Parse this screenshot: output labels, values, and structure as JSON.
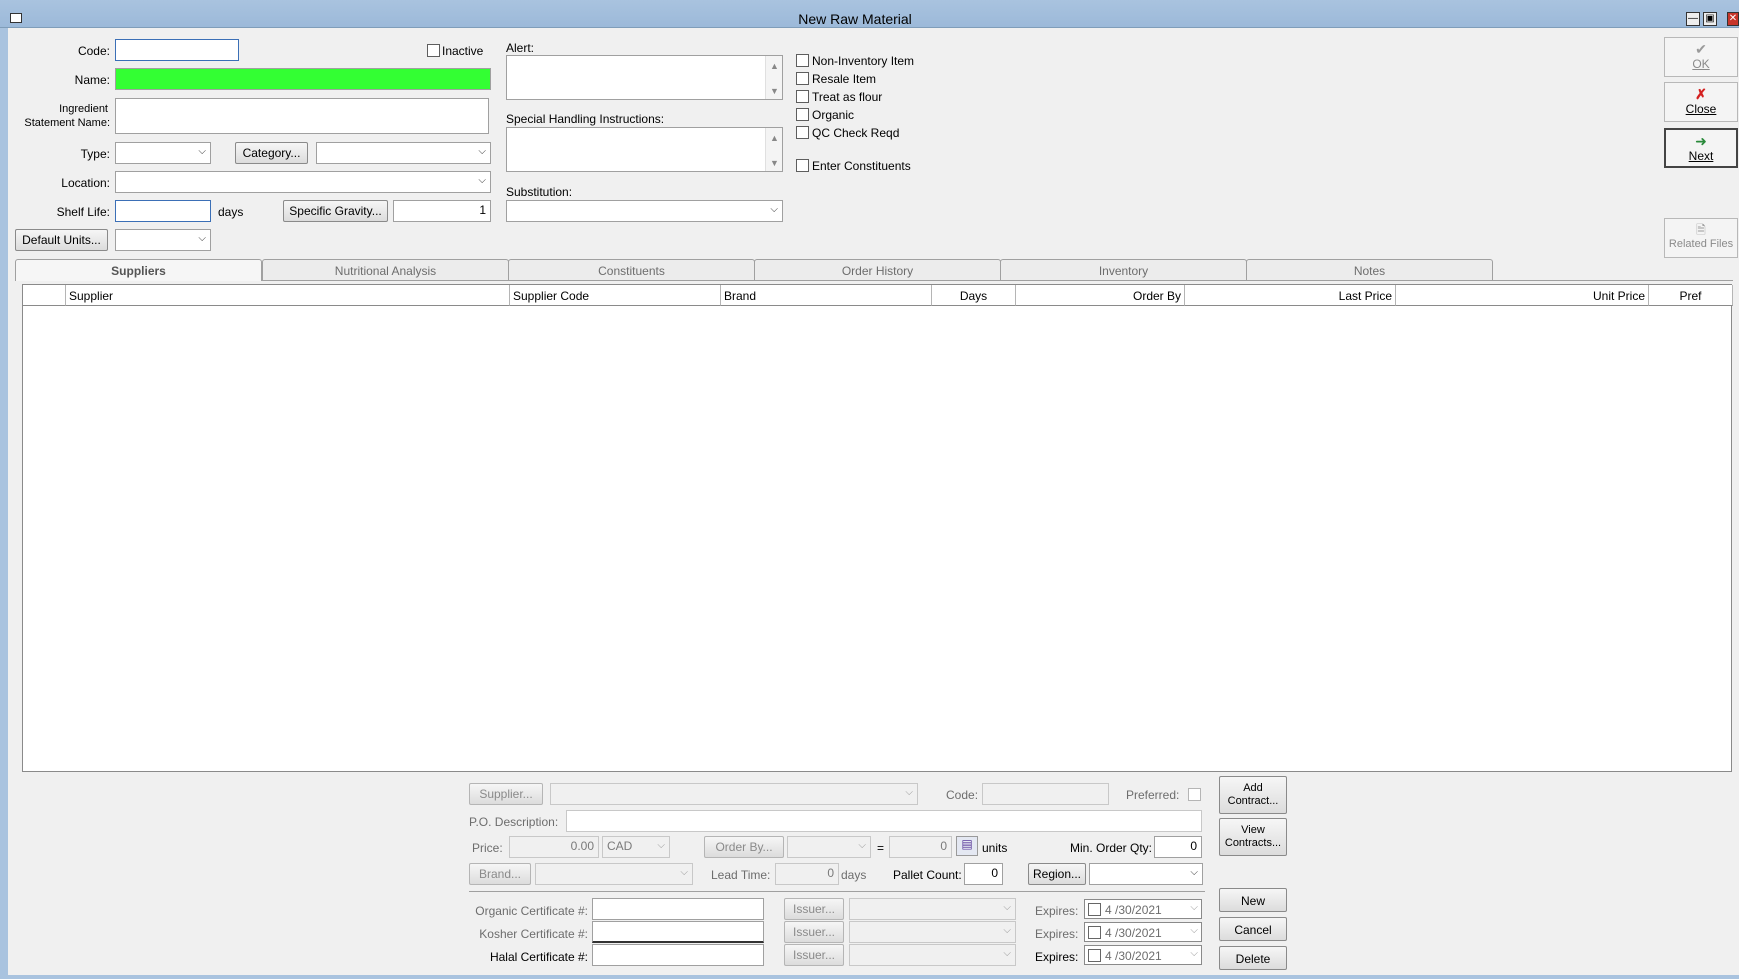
{
  "window": {
    "title": "New Raw Material"
  },
  "form": {
    "code_label": "Code:",
    "code_value": "",
    "inactive_label": "Inactive",
    "name_label": "Name:",
    "ingredient_label_1": "Ingredient",
    "ingredient_label_2": "Statement Name:",
    "type_label": "Type:",
    "category_button": "Category...",
    "location_label": "Location:",
    "shelf_life_label": "Shelf Life:",
    "days_label": "days",
    "specific_gravity_button": "Specific Gravity...",
    "specific_gravity_value": "1",
    "default_units_button": "Default Units...",
    "alert_label": "Alert:",
    "special_handling_label": "Special Handling Instructions:",
    "substitution_label": "Substitution:",
    "checkboxes": {
      "non_inventory": "Non-Inventory Item",
      "resale": "Resale Item",
      "treat_as_flour": "Treat as flour",
      "organic": "Organic",
      "qc_check": "QC Check Reqd",
      "enter_constituents": "Enter Constituents"
    }
  },
  "toolbar": {
    "ok": "OK",
    "close": "Close",
    "next": "Next",
    "related_files": "Related Files"
  },
  "tabs": [
    "Suppliers",
    "Nutritional Analysis",
    "Constituents",
    "Order History",
    "Inventory",
    "Notes"
  ],
  "grid": {
    "columns": [
      "Supplier",
      "Supplier Code",
      "Brand",
      "Days",
      "Order By",
      "Last Price",
      "Unit Price",
      "Pref"
    ]
  },
  "detail": {
    "supplier_button": "Supplier...",
    "code_label": "Code:",
    "preferred_label": "Preferred:",
    "po_description_label": "P.O. Description:",
    "price_label": "Price:",
    "price_value": "0.00",
    "currency": "CAD",
    "order_by_button": "Order By...",
    "equals": "=",
    "units_value": "0",
    "units_label": "units",
    "min_order_label": "Min. Order Qty:",
    "min_order_value": "0",
    "brand_button": "Brand...",
    "lead_time_label": "Lead Time:",
    "lead_time_value": "0",
    "days_label": "days",
    "pallet_count_label": "Pallet Count:",
    "pallet_count_value": "0",
    "region_button": "Region...",
    "organic_cert_label": "Organic Certificate #:",
    "kosher_cert_label": "Kosher Certificate #:",
    "halal_cert_label": "Halal Certificate #:",
    "issuer_button": "Issuer...",
    "expires_label": "Expires:",
    "expires_date": "4 /30/2021"
  },
  "side_buttons": {
    "add_contract_1": "Add",
    "add_contract_2": "Contract...",
    "view_contracts_1": "View",
    "view_contracts_2": "Contracts...",
    "new": "New",
    "cancel": "Cancel",
    "delete": "Delete"
  },
  "colors": {
    "name_field_bg": "#33ff33",
    "titlebar": "#a9c3df",
    "close_icon": "#d42020",
    "focus_border": "#3b6fb6"
  }
}
